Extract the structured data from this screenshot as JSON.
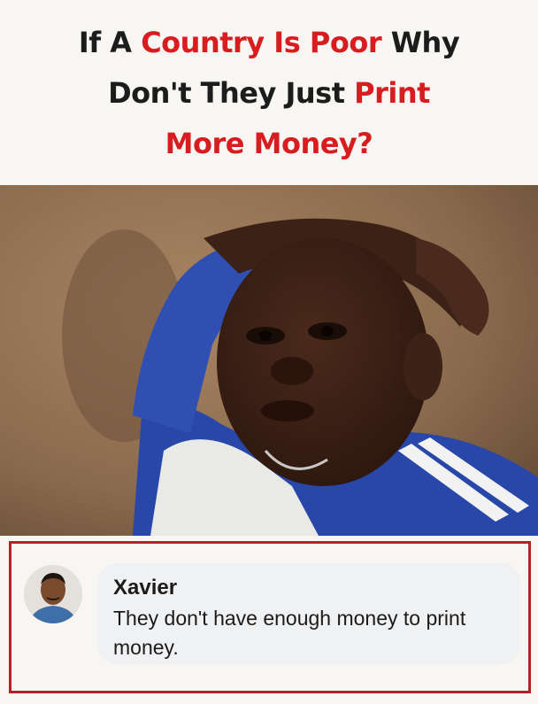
{
  "title": {
    "line1_a": "If A ",
    "line1_b": "Country Is Poor",
    "line1_c": " Why",
    "line2_a": "Don't They Just ",
    "line2_b": "Print",
    "line3": "More Money?"
  },
  "photo": {
    "icon": "boy-portrait-photo"
  },
  "comment": {
    "name": "Xavier",
    "text": "They don't have enough money to print money.",
    "avatar_icon": "avatar-photo"
  },
  "colors": {
    "accent_red": "#d81d20",
    "border_red": "#b42127",
    "text_dark": "#1c1c1c",
    "bubble_bg": "#f0f1f3"
  }
}
